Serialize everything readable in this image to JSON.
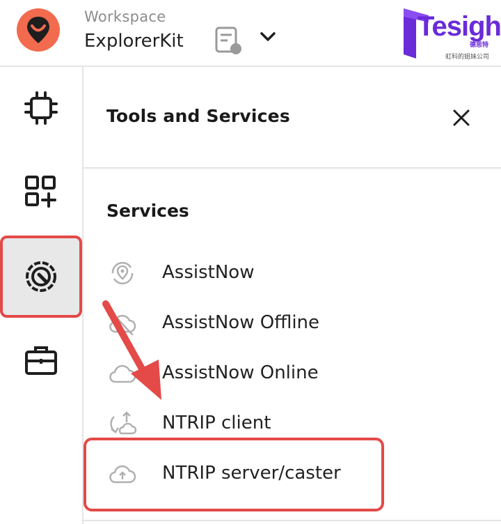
{
  "header": {
    "workspace_label": "Workspace",
    "workspace_name": "ExplorerKit",
    "brand_name": "Tesight",
    "brand_cn": "德思特",
    "brand_sub": "虹科的姐妹公司"
  },
  "rail": {
    "items": [
      {
        "icon": "chip-icon"
      },
      {
        "icon": "apps-add-icon"
      },
      {
        "icon": "tools-services-icon",
        "active": true
      },
      {
        "icon": "briefcase-icon"
      }
    ]
  },
  "panel": {
    "title": "Tools and Services",
    "section_title": "Services",
    "services": [
      {
        "label": "AssistNow",
        "icon": "location-sync-icon"
      },
      {
        "label": "AssistNow Offline",
        "icon": "cloud-offline-icon"
      },
      {
        "label": "AssistNow Online",
        "icon": "cloud-icon"
      },
      {
        "label": "NTRIP client",
        "icon": "ntrip-client-icon"
      },
      {
        "label": "NTRIP server/caster",
        "icon": "cloud-upload-icon"
      }
    ]
  },
  "colors": {
    "logo_orange": "#f26b4f",
    "highlight_red": "#e34a48",
    "brand_purple": "#6a2bd8",
    "active_rail_bg": "#e8e8e8"
  }
}
